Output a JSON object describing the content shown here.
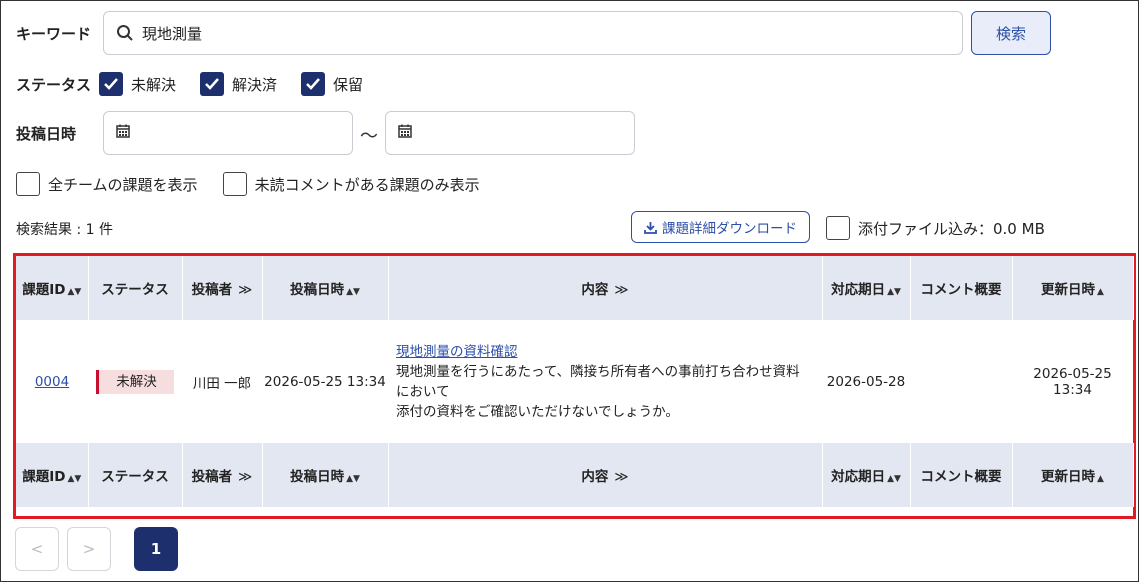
{
  "filters": {
    "keyword_label": "キーワード",
    "keyword_value": "現地測量",
    "search_button": "検索",
    "status_label": "ステータス",
    "statuses": [
      {
        "label": "未解決",
        "checked": true
      },
      {
        "label": "解決済",
        "checked": true
      },
      {
        "label": "保留",
        "checked": true
      }
    ],
    "date_label": "投稿日時",
    "date_from": "",
    "date_to": "",
    "date_separator": "～",
    "show_all_teams": {
      "label": "全チームの課題を表示",
      "checked": false
    },
    "unread_only": {
      "label": "未読コメントがある課題のみ表示",
      "checked": false
    }
  },
  "results": {
    "count_text": "検索結果 : 1 件",
    "download_button": "課題詳細ダウンロード",
    "include_attachments": {
      "label": "添付ファイル込み：0.0 MB",
      "checked": false
    }
  },
  "table": {
    "headers": [
      "課題ID",
      "ステータス",
      "投稿者",
      "投稿日時",
      "内容",
      "対応期日",
      "コメント概要",
      "更新日時"
    ],
    "rows": [
      {
        "id": "0004",
        "status": "未解決",
        "poster": "川田 一郎",
        "posted": "2026-05-25 13:34",
        "title": "現地測量の資料確認",
        "body_line1": "現地測量を行うにあたって、隣接ち所有者への事前打ち合わせ資料",
        "body_line2": "において",
        "body_line3": "添付の資料をご確認いただけないでしょうか。",
        "due": "2026-05-28",
        "comment": "",
        "updated": "2026-05-25 13:34"
      }
    ]
  },
  "pagination": {
    "prev": "<",
    "next": ">",
    "current": "1"
  },
  "colors": {
    "accent": "#1e2f6d",
    "link": "#2d4fa8",
    "highlight": "#e01b24",
    "status_unresolved": "#c8102e"
  }
}
